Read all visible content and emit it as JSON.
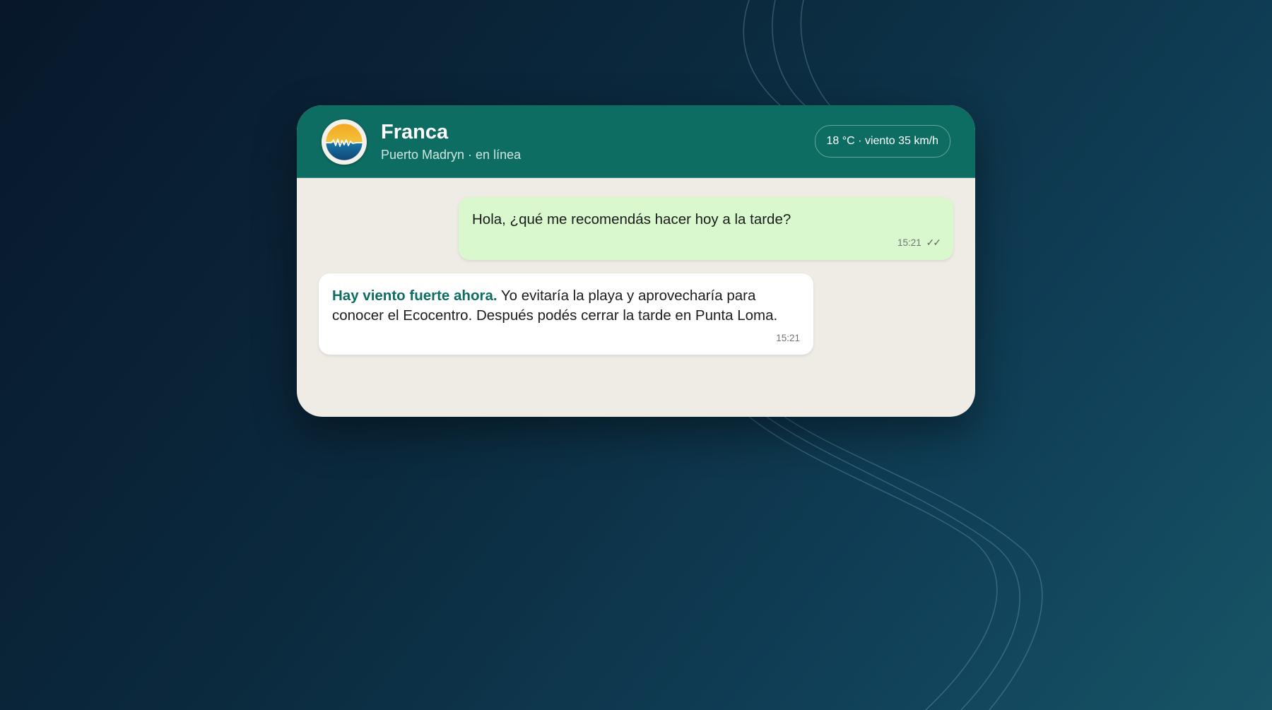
{
  "contact": {
    "name": "Franca",
    "status": "Puerto Madryn · en línea",
    "avatar_icon": "sunset-sea-logo-icon"
  },
  "weather": {
    "label": "18 °C · viento 35 km/h"
  },
  "messages": [
    {
      "direction": "outgoing",
      "text": "Hola, ¿qué me recomendás hacer hoy a la tarde?",
      "time": "15:21",
      "status_icon": "double-check-icon",
      "status_glyph": "✓✓"
    },
    {
      "direction": "incoming",
      "highlight": "Hay viento fuerte ahora.",
      "text": " Yo evitaría la playa y aprovecharía para conocer el Ecocentro. Después podés cerrar la tarde en Punta Loma.",
      "time": "15:21"
    }
  ],
  "colors": {
    "header": "#0e6d62",
    "chat_background": "#efebe5",
    "outgoing_bubble": "#d9f8cd",
    "incoming_bubble": "#ffffff",
    "accent_text": "#0e6d62"
  }
}
